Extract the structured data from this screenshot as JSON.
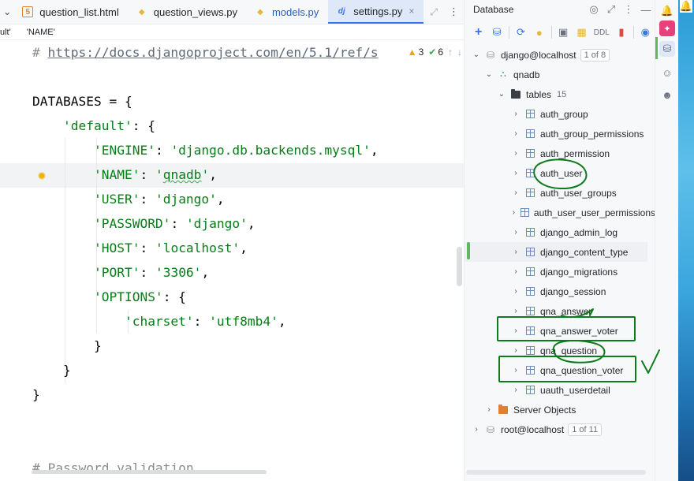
{
  "editor": {
    "tabs": [
      {
        "label": "question_list.html",
        "icon": "html-file-icon"
      },
      {
        "label": "question_views.py",
        "icon": "python-file-icon"
      },
      {
        "label": "models.py",
        "icon": "python-file-icon"
      },
      {
        "label": "settings.py",
        "icon": "django-file-icon",
        "active": true
      }
    ],
    "close_glyph": "×",
    "breadcrumb": [
      "ult'",
      "'NAME'"
    ],
    "inspections": {
      "warnings": "3",
      "weak_warnings": "6"
    },
    "code_lines": [
      {
        "parts": [
          {
            "t": "# ",
            "c": "c-comment"
          },
          {
            "t": "https://docs.djangoproject.com/en/5.1/ref/s",
            "c": "c-url"
          }
        ]
      },
      {
        "parts": []
      },
      {
        "parts": [
          {
            "t": "DATABASES = {",
            "c": "c-ident"
          }
        ]
      },
      {
        "parts": [
          {
            "t": "    ",
            "c": "c-ident"
          },
          {
            "t": "'default'",
            "c": "c-str"
          },
          {
            "t": ": {",
            "c": "c-ident"
          }
        ]
      },
      {
        "parts": [
          {
            "t": "        ",
            "c": "c-ident"
          },
          {
            "t": "'ENGINE'",
            "c": "c-str"
          },
          {
            "t": ": ",
            "c": "c-ident"
          },
          {
            "t": "'django.db.backends.mysql'",
            "c": "c-str"
          },
          {
            "t": ",",
            "c": "c-ident"
          }
        ]
      },
      {
        "parts": [
          {
            "t": "        ",
            "c": "c-ident"
          },
          {
            "t": "'NAME'",
            "c": "c-str"
          },
          {
            "t": ": ",
            "c": "c-ident"
          },
          {
            "t": "'",
            "c": "c-str"
          },
          {
            "t": "qnadb",
            "c": "c-str c-squiggle"
          },
          {
            "t": "'",
            "c": "c-str"
          },
          {
            "t": ",",
            "c": "c-ident"
          }
        ]
      },
      {
        "parts": [
          {
            "t": "        ",
            "c": "c-ident"
          },
          {
            "t": "'USER'",
            "c": "c-str"
          },
          {
            "t": ": ",
            "c": "c-ident"
          },
          {
            "t": "'django'",
            "c": "c-str"
          },
          {
            "t": ",",
            "c": "c-ident"
          }
        ]
      },
      {
        "parts": [
          {
            "t": "        ",
            "c": "c-ident"
          },
          {
            "t": "'PASSWORD'",
            "c": "c-str"
          },
          {
            "t": ": ",
            "c": "c-ident"
          },
          {
            "t": "'django'",
            "c": "c-str"
          },
          {
            "t": ",",
            "c": "c-ident"
          }
        ]
      },
      {
        "parts": [
          {
            "t": "        ",
            "c": "c-ident"
          },
          {
            "t": "'HOST'",
            "c": "c-str"
          },
          {
            "t": ": ",
            "c": "c-ident"
          },
          {
            "t": "'localhost'",
            "c": "c-str"
          },
          {
            "t": ",",
            "c": "c-ident"
          }
        ]
      },
      {
        "parts": [
          {
            "t": "        ",
            "c": "c-ident"
          },
          {
            "t": "'PORT'",
            "c": "c-str"
          },
          {
            "t": ": ",
            "c": "c-ident"
          },
          {
            "t": "'3306'",
            "c": "c-str"
          },
          {
            "t": ",",
            "c": "c-ident"
          }
        ]
      },
      {
        "parts": [
          {
            "t": "        ",
            "c": "c-ident"
          },
          {
            "t": "'OPTIONS'",
            "c": "c-str"
          },
          {
            "t": ": {",
            "c": "c-ident"
          }
        ]
      },
      {
        "parts": [
          {
            "t": "            ",
            "c": "c-ident"
          },
          {
            "t": "'charset'",
            "c": "c-str"
          },
          {
            "t": ": ",
            "c": "c-ident"
          },
          {
            "t": "'utf8mb4'",
            "c": "c-str"
          },
          {
            "t": ",",
            "c": "c-ident"
          }
        ]
      },
      {
        "parts": [
          {
            "t": "        }",
            "c": "c-ident"
          }
        ]
      },
      {
        "parts": [
          {
            "t": "    }",
            "c": "c-ident"
          }
        ]
      },
      {
        "parts": [
          {
            "t": "}",
            "c": "c-ident"
          }
        ]
      },
      {
        "parts": []
      },
      {
        "parts": []
      },
      {
        "parts": [
          {
            "t": "# Password validation",
            "c": "c-comment"
          }
        ]
      }
    ]
  },
  "database": {
    "title": "Database",
    "toolbar": {
      "ddl_label": "DDL"
    },
    "tree": [
      {
        "level": 0,
        "chev": "⌄",
        "icon": "db",
        "label": "django@localhost",
        "badge": "1 of 8"
      },
      {
        "level": 1,
        "chev": "⌄",
        "icon": "schema",
        "label": "qnadb"
      },
      {
        "level": 2,
        "chev": "⌄",
        "icon": "folder",
        "label": "tables",
        "count": "15"
      },
      {
        "level": 3,
        "chev": "›",
        "icon": "table",
        "label": "auth_group"
      },
      {
        "level": 3,
        "chev": "›",
        "icon": "table",
        "label": "auth_group_permissions"
      },
      {
        "level": 3,
        "chev": "›",
        "icon": "table",
        "label": "auth_permission"
      },
      {
        "level": 3,
        "chev": "›",
        "icon": "table",
        "label": "auth_user"
      },
      {
        "level": 3,
        "chev": "›",
        "icon": "table",
        "label": "auth_user_groups"
      },
      {
        "level": 3,
        "chev": "›",
        "icon": "table",
        "label": "auth_user_user_permissions"
      },
      {
        "level": 3,
        "chev": "›",
        "icon": "table",
        "label": "django_admin_log"
      },
      {
        "level": 3,
        "chev": "›",
        "icon": "table",
        "label": "django_content_type",
        "selected": true
      },
      {
        "level": 3,
        "chev": "›",
        "icon": "table",
        "label": "django_migrations"
      },
      {
        "level": 3,
        "chev": "›",
        "icon": "table",
        "label": "django_session"
      },
      {
        "level": 3,
        "chev": "›",
        "icon": "table",
        "label": "qna_answer"
      },
      {
        "level": 3,
        "chev": "›",
        "icon": "table",
        "label": "qna_answer_voter"
      },
      {
        "level": 3,
        "chev": "›",
        "icon": "table",
        "label": "qna_question"
      },
      {
        "level": 3,
        "chev": "›",
        "icon": "table",
        "label": "qna_question_voter"
      },
      {
        "level": 3,
        "chev": "›",
        "icon": "table",
        "label": "uauth_userdetail"
      },
      {
        "level": 1,
        "chev": "›",
        "icon": "server",
        "label": "Server Objects"
      },
      {
        "level": 0,
        "chev": "›",
        "icon": "db",
        "label": "root@localhost",
        "badge": "1 of 11"
      }
    ]
  },
  "colors": {
    "annotation": "#0e7c1d",
    "accent": "#3574f0",
    "string": "#067d17"
  }
}
